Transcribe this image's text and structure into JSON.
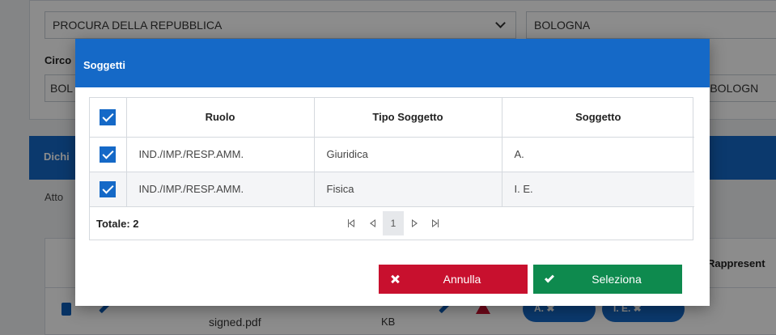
{
  "background": {
    "procura_select": "PROCURA DELLA REPUBBLICA",
    "city_select": "BOLOGNA",
    "circ_label": "Circo",
    "circ_select": "BOL",
    "right_select": "A DI BOLOGN",
    "section_title": "Dichi",
    "atto_label": "Atto",
    "rappresent_header": "Rappresent",
    "file_name": "signed.pdf",
    "file_unit": "KB",
    "chips": [
      "A.",
      "I. E."
    ]
  },
  "modal": {
    "title": "Soggetti",
    "columns": [
      "Ruolo",
      "Tipo Soggetto",
      "Soggetto"
    ],
    "rows": [
      {
        "checked": true,
        "ruolo": "IND./IMP./RESP.AMM.",
        "tipo": "Giuridica",
        "soggetto": "A."
      },
      {
        "checked": true,
        "ruolo": "IND./IMP./RESP.AMM.",
        "tipo": "Fisica",
        "soggetto": "I. E."
      }
    ],
    "totale_label": "Totale: 2",
    "current_page": "1",
    "cancel_label": "Annulla",
    "select_label": "Seleziona"
  },
  "colors": {
    "primary_blue": "#1569c7",
    "cancel_red": "#c8102e",
    "select_green": "#0e8a4e"
  },
  "icons": [
    "check-icon",
    "first-page-icon",
    "prev-page-icon",
    "next-page-icon",
    "last-page-icon",
    "close-icon",
    "checkmark-icon",
    "trash-icon",
    "pencil-icon",
    "warning-icon"
  ]
}
